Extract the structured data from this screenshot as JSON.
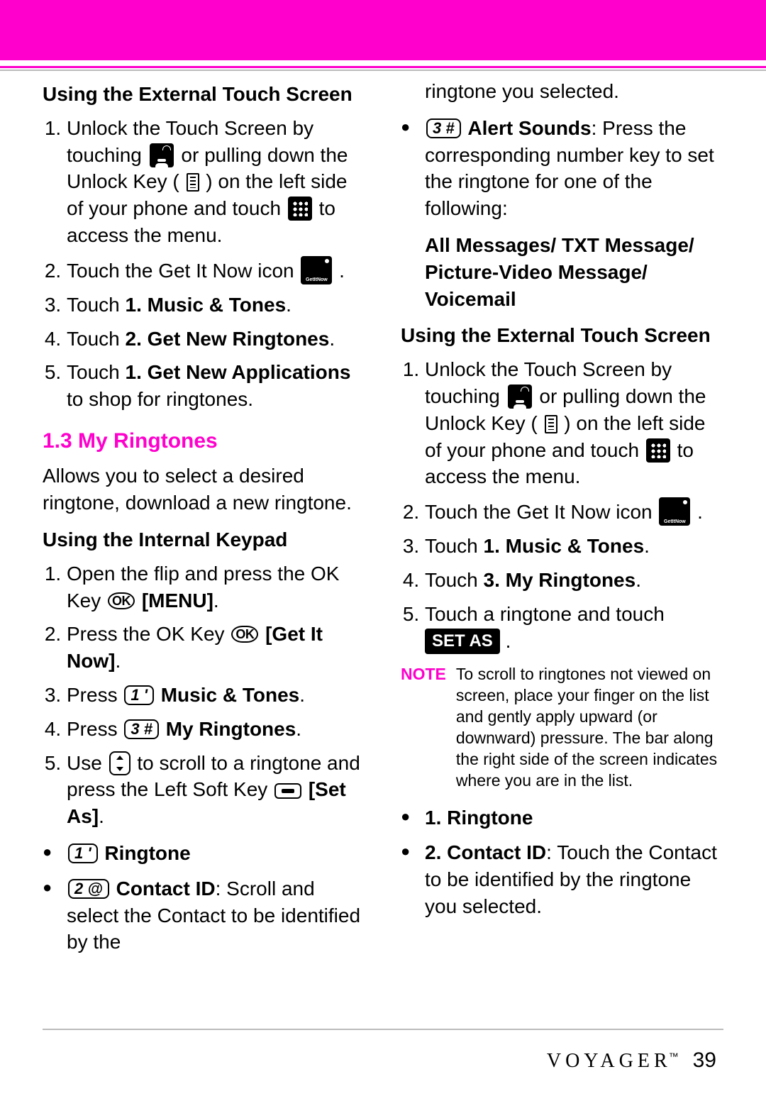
{
  "section_a_title": "Using the External Touch Screen",
  "a_steps": {
    "s1_a": "Unlock the Touch Screen by touching ",
    "s1_b": " or pulling down the Unlock Key ( ",
    "s1_c": " ) on the left side of your phone and touch ",
    "s1_d": " to access the menu.",
    "s2_a": "Touch the Get It Now icon ",
    "s2_b": ".",
    "s3_a": "Touch ",
    "s3_b": "1. Music & Tones",
    "s3_c": ".",
    "s4_a": "Touch ",
    "s4_b": "2. Get New Ringtones",
    "s4_c": ".",
    "s5_a": "Touch ",
    "s5_b": "1. Get New Applications",
    "s5_c": " to shop for ringtones."
  },
  "sec13_title": "1.3 My Ringtones",
  "sec13_desc": "Allows you to select a desired ringtone, download a new ringtone.",
  "section_b_title": "Using the Internal Keypad",
  "b_steps": {
    "s1_a": "Open the flip and press the OK Key ",
    "s1_menu": "[MENU]",
    "s1_c": ".",
    "s2_a": "Press the OK Key ",
    "s2_b": "[Get It Now]",
    "s2_c": ".",
    "s3_a": "Press ",
    "s3_b": "Music & Tones",
    "s3_c": ".",
    "s4_a": "Press ",
    "s4_b": "My Ringtones",
    "s4_c": ".",
    "s5_a": "Use ",
    "s5_b": " to scroll to a ringtone and press the Left Soft Key ",
    "s5_c": "[Set As]",
    "s5_d": "."
  },
  "b_bullets": {
    "b1_label": "Ringtone",
    "b2_label": "Contact ID",
    "b2_text": ": Scroll and select the Contact to be identified by the"
  },
  "col2_top": "ringtone you selected.",
  "c_bullets": {
    "b3_label": "Alert Sounds",
    "b3_text": ": Press the corresponding number key to set the ringtone for one of the following:"
  },
  "alert_list": "All Messages/ TXT Message/ Picture-Video Message/ Voicemail",
  "section_c_title": "Using the External Touch Screen",
  "c_steps": {
    "s1_a": "Unlock the Touch Screen by touching ",
    "s1_b": " or pulling down the Unlock Key ( ",
    "s1_c": " ) on the left side of your phone and touch ",
    "s1_d": " to access the menu.",
    "s2_a": "Touch the Get It Now icon ",
    "s2_b": ".",
    "s3_a": "Touch ",
    "s3_b": "1. Music & Tones",
    "s3_c": ".",
    "s4_a": "Touch ",
    "s4_b": "3. My Ringtones",
    "s4_c": ".",
    "s5_a": "Touch a ringtone and touch ",
    "s5_pill": "SET AS",
    "s5_c": "."
  },
  "note_label": "NOTE",
  "note_text": "To scroll to ringtones not viewed on screen, place your finger on the list and gently apply upward (or downward) pressure. The bar along the right side of the screen indicates where you are in the list.",
  "d_bullets": {
    "b1_label": "1. Ringtone",
    "b2_label": "2. Contact ID",
    "b2_text": ": Touch the Contact to be identified by the ringtone you selected."
  },
  "keys": {
    "one": "1 '",
    "two": "2 @",
    "three": "3 #",
    "ok": "OK"
  },
  "footer": {
    "brand": "VOYAGER",
    "tm": "™",
    "page": "39"
  }
}
